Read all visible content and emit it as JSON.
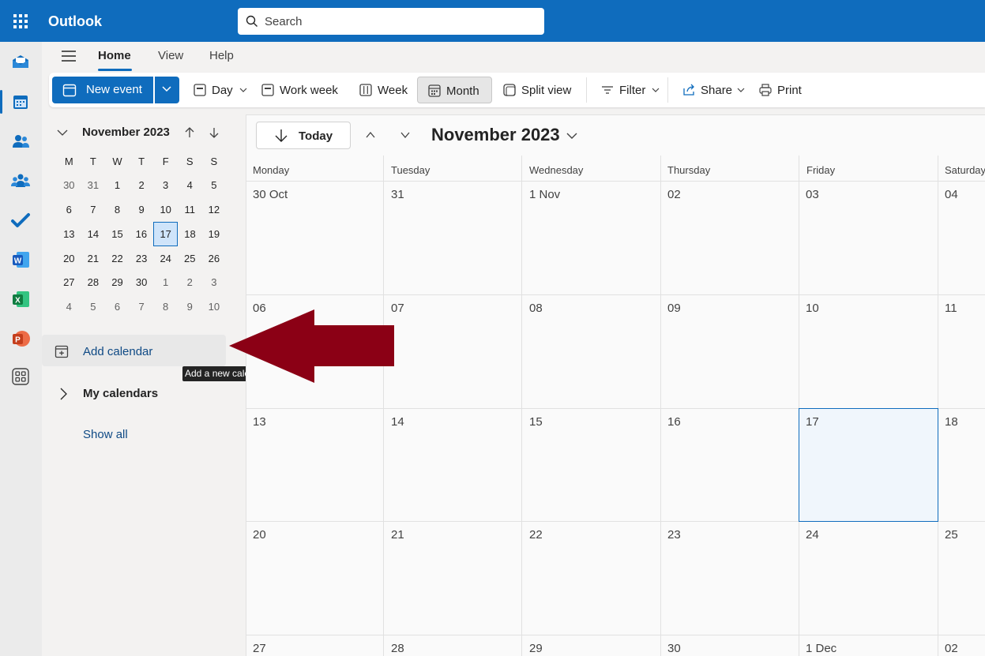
{
  "app": {
    "title": "Outlook"
  },
  "search": {
    "placeholder": "Search"
  },
  "rail": [
    {
      "icon": "mail-icon"
    },
    {
      "icon": "calendar-icon",
      "selected": true
    },
    {
      "icon": "people-icon"
    },
    {
      "icon": "groups-icon"
    },
    {
      "icon": "todo-icon"
    },
    {
      "icon": "word-icon"
    },
    {
      "icon": "excel-icon"
    },
    {
      "icon": "powerpoint-icon"
    },
    {
      "icon": "more-apps-icon"
    }
  ],
  "tabs": {
    "home": "Home",
    "view": "View",
    "help": "Help"
  },
  "ribbon": {
    "new_event": "New event",
    "day": "Day",
    "work_week": "Work week",
    "week": "Week",
    "month": "Month",
    "split_view": "Split view",
    "filter": "Filter",
    "share": "Share",
    "print": "Print",
    "selected_view": "Month"
  },
  "mini_calendar": {
    "title": "November 2023",
    "weekdays": [
      "M",
      "T",
      "W",
      "T",
      "F",
      "S",
      "S"
    ],
    "weeks": [
      [
        "30",
        "31",
        "1",
        "2",
        "3",
        "4",
        "5"
      ],
      [
        "6",
        "7",
        "8",
        "9",
        "10",
        "11",
        "12"
      ],
      [
        "13",
        "14",
        "15",
        "16",
        "17",
        "18",
        "19"
      ],
      [
        "20",
        "21",
        "22",
        "23",
        "24",
        "25",
        "26"
      ],
      [
        "27",
        "28",
        "29",
        "30",
        "1",
        "2",
        "3"
      ],
      [
        "4",
        "5",
        "6",
        "7",
        "8",
        "9",
        "10"
      ]
    ],
    "today": "17"
  },
  "sidebar": {
    "add_calendar": "Add calendar",
    "tooltip": "Add a new calendar",
    "my_calendars": "My calendars",
    "show_all": "Show all"
  },
  "colors": {
    "accent": "#0f6cbd",
    "annotation_arrow": "#8b0015"
  },
  "main": {
    "today_button": "Today",
    "month_title": "November 2023",
    "day_headers": [
      "Monday",
      "Tuesday",
      "Wednesday",
      "Thursday",
      "Friday",
      "Saturday"
    ],
    "weeks": [
      [
        "30 Oct",
        "31",
        "1 Nov",
        "02",
        "03",
        "04"
      ],
      [
        "06",
        "07",
        "08",
        "09",
        "10",
        "11"
      ],
      [
        "13",
        "14",
        "15",
        "16",
        "17",
        "18"
      ],
      [
        "20",
        "21",
        "22",
        "23",
        "24",
        "25"
      ],
      [
        "27",
        "28",
        "29",
        "30",
        "1 Dec",
        "02"
      ]
    ],
    "today_label": "17"
  }
}
